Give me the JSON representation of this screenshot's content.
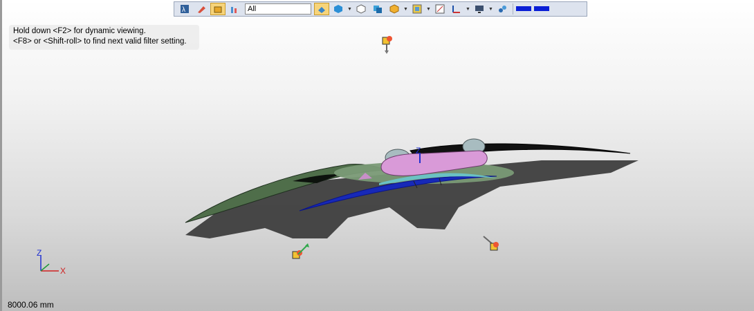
{
  "toolbar": {
    "filter_value": "All",
    "buttons": [
      "dynamic-view-icon",
      "eraser-icon",
      "selection-box-icon",
      "filter-icon"
    ],
    "view_buttons": [
      "orient-view-icon",
      "iso-cube-icon",
      "wireframe-cube-icon",
      "shaded-cube-icon",
      "render-mode-icon",
      "frame-icon",
      "zoom-fit-icon",
      "axis-tool-icon",
      "display-icon",
      "layers-icon"
    ],
    "colors": {
      "active": "#f7d47a",
      "line_bar": "#0a1fd6"
    }
  },
  "hint": {
    "line1": "Hold down <F2> for dynamic viewing.",
    "line2": "<F8> or <Shift-roll> to find next valid filter setting."
  },
  "triad": {
    "z_label": "Z",
    "x_label": "X"
  },
  "model_axis_label": "Z",
  "scale_text": "8000.06 mm",
  "colors": {
    "wing_green": "#4f6e4a",
    "fuselage": "#d99ad8",
    "blue_wing": "#1729b8",
    "teal_wing": "#6ac2c4",
    "shadow": "#3c3c3c"
  }
}
